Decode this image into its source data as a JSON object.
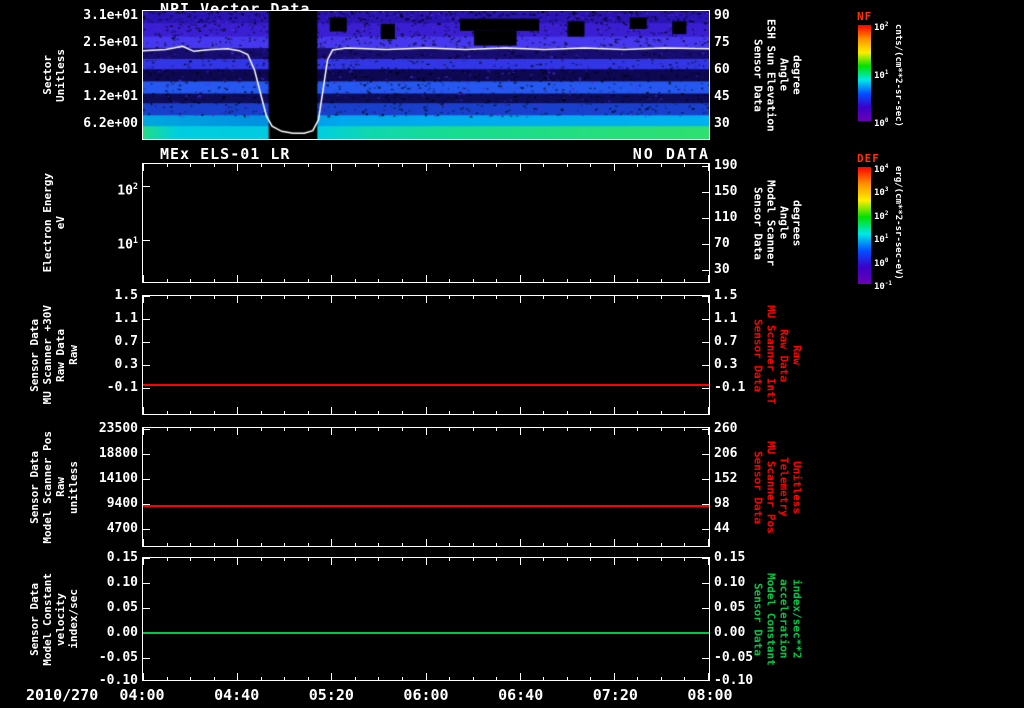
{
  "colors": {
    "background": "#000000",
    "axis": "#ffffff",
    "text": "#ffffff",
    "red": "#ff0000",
    "green": "#00c846",
    "white_line": "#ffffff",
    "colorbar_title": "#ff3200"
  },
  "xaxis": {
    "date_label": "2010/270",
    "time_ticks": [
      "04:00",
      "04:40",
      "05:20",
      "06:00",
      "06:40",
      "07:20",
      "08:00"
    ],
    "tick_fracs": [
      0,
      0.1667,
      0.3333,
      0.5,
      0.6667,
      0.8333,
      1
    ]
  },
  "colorbars": [
    {
      "title": "NF",
      "units": "cnts/(cm**2-sr-sec)",
      "scale": "log",
      "ticks": [
        {
          "label": "10^2",
          "frac": 0
        },
        {
          "label": "10^1",
          "frac": 0.5
        },
        {
          "label": "10^0",
          "frac": 1
        }
      ],
      "gradient": [
        "#ff0000",
        "#ff9000",
        "#ffee00",
        "#00e000",
        "#00e8e8",
        "#0050ff",
        "#3c00c8",
        "#6a00b4"
      ]
    },
    {
      "title": "DEF",
      "units": "erg/(cm**2-sr-sec-eV)",
      "scale": "log",
      "ticks": [
        {
          "label": "10^4",
          "frac": 0
        },
        {
          "label": "10^3",
          "frac": 0.2
        },
        {
          "label": "10^2",
          "frac": 0.4
        },
        {
          "label": "10^1",
          "frac": 0.6
        },
        {
          "label": "10^0",
          "frac": 0.8
        },
        {
          "label": "10^-1",
          "frac": 1
        }
      ],
      "gradient": [
        "#ff0000",
        "#ff9000",
        "#ffee00",
        "#00e000",
        "#00e8e8",
        "#0050ff",
        "#3c00c8",
        "#6a00b4"
      ]
    }
  ],
  "chart_data": [
    {
      "type": "heatmap",
      "title": "NPI Vector Data",
      "left_axis": {
        "label_lines": [
          "Sector",
          "Unitless"
        ],
        "ticks": [
          {
            "label": "3.1e+01",
            "frac": 0.046
          },
          {
            "label": "2.5e+01",
            "frac": 0.254
          },
          {
            "label": "1.9e+01",
            "frac": 0.462
          },
          {
            "label": "1.2e+01",
            "frac": 0.669
          },
          {
            "label": "6.2e+00",
            "frac": 0.877
          }
        ]
      },
      "right_axis": {
        "label_lines": [
          "Sensor Data",
          "ESH Sun Elevation",
          "Angle",
          "degree"
        ],
        "color": "#ffffff",
        "ticks": [
          {
            "label": "90",
            "frac": 0.046
          },
          {
            "label": "75",
            "frac": 0.254
          },
          {
            "label": "60",
            "frac": 0.462
          },
          {
            "label": "45",
            "frac": 0.669
          },
          {
            "label": "30",
            "frac": 0.877
          }
        ]
      },
      "colorbar": "NF",
      "spectrogram": {
        "description": "NPI ion counts per sector vs time; vertical data gap ~05:00-05:15; white overlay = ESH sun elevation angle, flat near 75 deg dipping to ~28 deg around the gap",
        "gap": {
          "x0": 0.222,
          "x1": 0.308
        },
        "noise_seed": 13,
        "bands": [
          {
            "y0": 0.0,
            "y1": 0.095,
            "color": "#2a14b4"
          },
          {
            "y0": 0.095,
            "y1": 0.2,
            "color": "#3a1ed2"
          },
          {
            "y0": 0.2,
            "y1": 0.29,
            "color": "#4638f0"
          },
          {
            "y0": 0.29,
            "y1": 0.375,
            "color": "#170d70"
          },
          {
            "y0": 0.375,
            "y1": 0.455,
            "color": "#3136e6"
          },
          {
            "y0": 0.455,
            "y1": 0.55,
            "color": "#0d0850"
          },
          {
            "y0": 0.55,
            "y1": 0.645,
            "color": "#2458f0"
          },
          {
            "y0": 0.645,
            "y1": 0.72,
            "color": "#0c0c58"
          },
          {
            "y0": 0.72,
            "y1": 0.815,
            "color": "#1840cc"
          },
          {
            "y0": 0.815,
            "y1": 0.9,
            "color": "#00a8e8",
            "xstops": [
              [
                0,
                "#00a8e0"
              ],
              [
                0.22,
                "#0090e0"
              ],
              [
                0.35,
                "#00a8ee"
              ],
              [
                1,
                "#00b2f0"
              ]
            ]
          },
          {
            "y0": 0.9,
            "y1": 1.0,
            "color": "#00d8c0",
            "xstops": [
              [
                0,
                "#22dd88"
              ],
              [
                0.06,
                "#00cfe0"
              ],
              [
                0.2,
                "#00cbe0"
              ],
              [
                0.31,
                "#00cfe0"
              ],
              [
                0.4,
                "#10d8b0"
              ],
              [
                0.55,
                "#18dc90"
              ],
              [
                1,
                "#30e070"
              ]
            ]
          }
        ],
        "dark_patches": [
          {
            "x0": 0.56,
            "x1": 0.7,
            "y0": 0.06,
            "y1": 0.155
          },
          {
            "x0": 0.585,
            "x1": 0.66,
            "y0": 0.155,
            "y1": 0.27
          },
          {
            "x0": 0.75,
            "x1": 0.78,
            "y0": 0.08,
            "y1": 0.2
          },
          {
            "x0": 0.33,
            "x1": 0.36,
            "y0": 0.05,
            "y1": 0.16
          },
          {
            "x0": 0.42,
            "x1": 0.445,
            "y0": 0.1,
            "y1": 0.22
          },
          {
            "x0": 0.86,
            "x1": 0.89,
            "y0": 0.05,
            "y1": 0.14
          },
          {
            "x0": 0.935,
            "x1": 0.96,
            "y0": 0.08,
            "y1": 0.18
          }
        ],
        "overlay_line": {
          "name": "sun-elevation-trace",
          "color": "#ffffff",
          "points": [
            [
              0,
              0.31
            ],
            [
              0.04,
              0.3
            ],
            [
              0.07,
              0.275
            ],
            [
              0.09,
              0.315
            ],
            [
              0.12,
              0.3
            ],
            [
              0.15,
              0.295
            ],
            [
              0.17,
              0.31
            ],
            [
              0.185,
              0.34
            ],
            [
              0.197,
              0.46
            ],
            [
              0.208,
              0.65
            ],
            [
              0.218,
              0.82
            ],
            [
              0.228,
              0.9
            ],
            [
              0.245,
              0.94
            ],
            [
              0.265,
              0.955
            ],
            [
              0.285,
              0.955
            ],
            [
              0.3,
              0.935
            ],
            [
              0.31,
              0.85
            ],
            [
              0.318,
              0.62
            ],
            [
              0.326,
              0.38
            ],
            [
              0.335,
              0.305
            ],
            [
              0.36,
              0.29
            ],
            [
              0.43,
              0.3
            ],
            [
              0.5,
              0.29
            ],
            [
              0.57,
              0.3
            ],
            [
              0.64,
              0.29
            ],
            [
              0.71,
              0.3
            ],
            [
              0.78,
              0.29
            ],
            [
              0.85,
              0.3
            ],
            [
              0.92,
              0.29
            ],
            [
              1,
              0.295
            ]
          ]
        }
      }
    },
    {
      "type": "heatmap",
      "title": "MEx ELS-01 LR",
      "status": "NO DATA",
      "left_axis": {
        "label_lines": [
          "Electron Energy",
          "eV"
        ],
        "ticks": [
          {
            "label": "10^2",
            "frac": 0.19
          },
          {
            "label": "10^1",
            "frac": 0.64
          }
        ]
      },
      "right_axis": {
        "label_lines": [
          "Sensor Data",
          "Model Scanner",
          "Angle",
          "degrees"
        ],
        "color": "#ffffff",
        "ticks": [
          {
            "label": "190",
            "frac": 0.025
          },
          {
            "label": "150",
            "frac": 0.242
          },
          {
            "label": "110",
            "frac": 0.458
          },
          {
            "label": "70",
            "frac": 0.675
          },
          {
            "label": "30",
            "frac": 0.892
          }
        ]
      },
      "colorbar": "DEF",
      "series": []
    },
    {
      "type": "line",
      "left_axis": {
        "label_lines": [
          "Sensor Data",
          "MU Scanner +30V",
          "Raw Data",
          "Raw"
        ],
        "ticks": [
          {
            "label": "1.5",
            "frac": 0.008
          },
          {
            "label": "1.1",
            "frac": 0.2
          },
          {
            "label": "0.7",
            "frac": 0.392
          },
          {
            "label": "0.3",
            "frac": 0.583
          },
          {
            "label": "-0.1",
            "frac": 0.775
          }
        ]
      },
      "right_axis": {
        "label_lines": [
          "Sensor Data",
          "MU Scanner IntT",
          "Raw Data",
          "Raw"
        ],
        "color": "#ff0000",
        "ticks": [
          {
            "label": "1.5",
            "frac": 0.008
          },
          {
            "label": "1.1",
            "frac": 0.2
          },
          {
            "label": "0.7",
            "frac": 0.392
          },
          {
            "label": "0.3",
            "frac": 0.583
          },
          {
            "label": "-0.1",
            "frac": 0.775
          }
        ]
      },
      "series": [
        {
          "name": "MU Scanner +30V Raw Data",
          "color": "#ff0000",
          "constant_value": -0.06,
          "y_frac": 0.75
        }
      ]
    },
    {
      "type": "line",
      "left_axis": {
        "label_lines": [
          "Sensor Data",
          "Model Scanner Pos",
          "Raw",
          "unitless"
        ],
        "ticks": [
          {
            "label": "23500",
            "frac": 0.017
          },
          {
            "label": "18800",
            "frac": 0.225
          },
          {
            "label": "14100",
            "frac": 0.433
          },
          {
            "label": "9400",
            "frac": 0.642
          },
          {
            "label": "4700",
            "frac": 0.85
          }
        ]
      },
      "right_axis": {
        "label_lines": [
          "Sensor Data",
          "MU Scanner Pos",
          "Telemetry",
          "Unitless"
        ],
        "color": "#ff0000",
        "ticks": [
          {
            "label": "260",
            "frac": 0.017
          },
          {
            "label": "206",
            "frac": 0.225
          },
          {
            "label": "152",
            "frac": 0.433
          },
          {
            "label": "98",
            "frac": 0.642
          },
          {
            "label": "44",
            "frac": 0.85
          }
        ]
      },
      "series": [
        {
          "name": "Model Scanner Pos Raw",
          "color": "#ff0000",
          "constant_value": 9300,
          "y_frac": 0.66
        }
      ]
    },
    {
      "type": "line",
      "left_axis": {
        "label_lines": [
          "Sensor Data",
          "Model Constant",
          "velocity",
          "index/sec"
        ],
        "ticks": [
          {
            "label": "0.15",
            "frac": 0.008
          },
          {
            "label": "0.10",
            "frac": 0.21
          },
          {
            "label": "0.05",
            "frac": 0.41
          },
          {
            "label": "0.00",
            "frac": 0.613
          },
          {
            "label": "-0.05",
            "frac": 0.815
          },
          {
            "label": "-0.10",
            "frac": 1.0
          }
        ]
      },
      "right_axis": {
        "label_lines": [
          "Sensor Data",
          "Model Constant",
          "acceleration",
          "index/sec**2"
        ],
        "color": "#00c846",
        "ticks": [
          {
            "label": "0.15",
            "frac": 0.008
          },
          {
            "label": "0.10",
            "frac": 0.21
          },
          {
            "label": "0.05",
            "frac": 0.41
          },
          {
            "label": "0.00",
            "frac": 0.613
          },
          {
            "label": "-0.05",
            "frac": 0.815
          },
          {
            "label": "-0.10",
            "frac": 1.0
          }
        ]
      },
      "series": [
        {
          "name": "Model Constant velocity",
          "color": "#00c846",
          "constant_value": 0.0,
          "y_frac": 0.613
        }
      ]
    }
  ]
}
